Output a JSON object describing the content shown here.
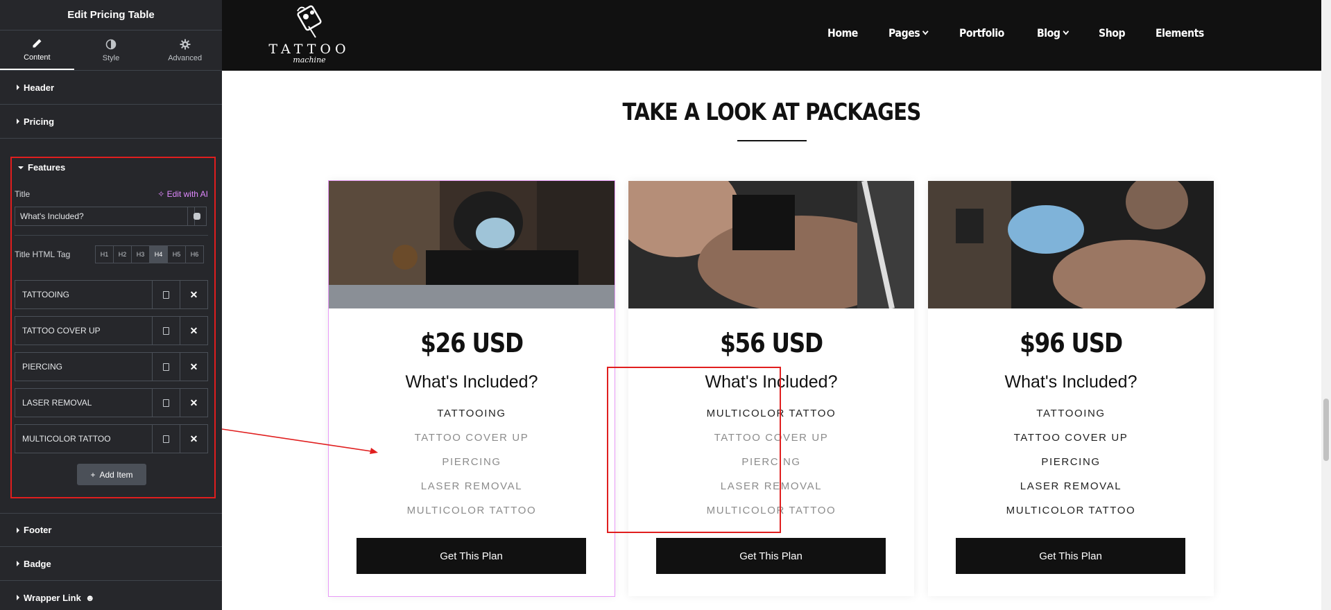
{
  "editor": {
    "title": "Edit Pricing Table",
    "tabs": [
      {
        "label": "Content",
        "icon": "pencil-icon",
        "active": true
      },
      {
        "label": "Style",
        "icon": "half-circle-icon",
        "active": false
      },
      {
        "label": "Advanced",
        "icon": "gear-icon",
        "active": false
      }
    ],
    "sections_top": [
      "Header",
      "Pricing"
    ],
    "features": {
      "section_label": "Features",
      "title_label": "Title",
      "ai_link": "Edit with AI",
      "title_value": "What's Included?",
      "html_tag_label": "Title HTML Tag",
      "html_tags": [
        "H1",
        "H2",
        "H3",
        "H4",
        "H5",
        "H6"
      ],
      "selected_tag": "H4",
      "items": [
        "TATTOOING",
        "TATTOO COVER UP",
        "PIERCING",
        "LASER REMOVAL",
        "MULTICOLOR TATTOO"
      ],
      "add_item": "Add Item"
    },
    "sections_bottom": [
      "Footer",
      "Badge",
      "Wrapper Link"
    ]
  },
  "site": {
    "logo": {
      "word": "TATTOO",
      "sub": "machine"
    },
    "menu": [
      {
        "label": "Home",
        "dropdown": false
      },
      {
        "label": "Pages",
        "dropdown": true
      },
      {
        "label": "Portfolio",
        "dropdown": false
      },
      {
        "label": "Blog",
        "dropdown": true
      },
      {
        "label": "Shop",
        "dropdown": false
      },
      {
        "label": "Elements",
        "dropdown": false
      }
    ],
    "heading": "TAKE A LOOK AT PACKAGES",
    "cards": [
      {
        "price": "$26 USD",
        "features_title": "What's Included?",
        "features": [
          {
            "text": "TATTOOING",
            "included": true
          },
          {
            "text": "TATTOO COVER UP",
            "included": false
          },
          {
            "text": "PIERCING",
            "included": false
          },
          {
            "text": "LASER REMOVAL",
            "included": false
          },
          {
            "text": "MULTICOLOR TATTOO",
            "included": false
          }
        ],
        "button": "Get This Plan"
      },
      {
        "price": "$56 USD",
        "features_title": "What's Included?",
        "features": [
          {
            "text": "MULTICOLOR TATTOO",
            "included": true
          },
          {
            "text": "TATTOO COVER UP",
            "included": false
          },
          {
            "text": "PIERCING",
            "included": false
          },
          {
            "text": "LASER REMOVAL",
            "included": false
          },
          {
            "text": "MULTICOLOR TATTOO",
            "included": false
          }
        ],
        "button": "Get This Plan"
      },
      {
        "price": "$96 USD",
        "features_title": "What's Included?",
        "features": [
          {
            "text": "TATTOOING",
            "included": true
          },
          {
            "text": "TATTOO COVER UP",
            "included": true
          },
          {
            "text": "PIERCING",
            "included": true
          },
          {
            "text": "LASER REMOVAL",
            "included": true
          },
          {
            "text": "MULTICOLOR TATTOO",
            "included": true
          }
        ],
        "button": "Get This Plan"
      }
    ]
  },
  "colors": {
    "panel_bg": "#26272b",
    "ai_accent": "#e089ff",
    "highlight_red": "#e01e1e",
    "selected_outline": "#e89af7",
    "nav_bg": "#111111"
  }
}
